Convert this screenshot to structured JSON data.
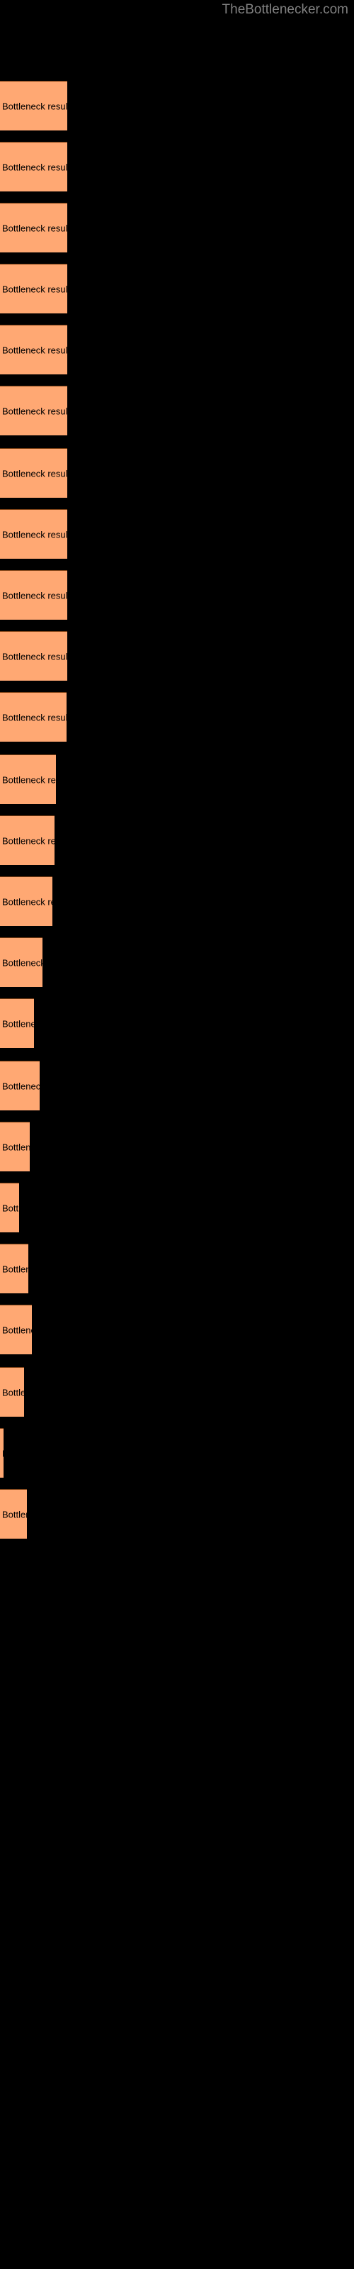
{
  "site": {
    "title": "TheBottlenecker.com",
    "title_color": "#808080"
  },
  "background_color": "#000000",
  "chart_data": {
    "type": "bar",
    "orientation": "horizontal",
    "title": "",
    "xlabel": "",
    "ylabel": "",
    "bar_color": "#FFA873",
    "bar_border_color": "#7a3f14",
    "label_color": "#000000",
    "grid": false,
    "legend": null,
    "bar_label": "Bottleneck result",
    "categories": [
      "Bottleneck result",
      "Bottleneck result",
      "Bottleneck result",
      "Bottleneck result",
      "Bottleneck result",
      "Bottleneck result",
      "Bottleneck result",
      "Bottleneck result",
      "Bottleneck result",
      "Bottleneck result",
      "Bottleneck result",
      "Bottleneck result",
      "Bottleneck result",
      "Bottleneck result",
      "Bottleneck result",
      "Bottleneck result",
      "Bottleneck result",
      "Bottleneck result",
      "Bottleneck result",
      "Bottleneck result",
      "Bottleneck result",
      "Bottleneck result",
      "Bottleneck result",
      "Bottleneck result"
    ],
    "values": [
      95,
      95,
      95,
      95,
      95,
      95,
      95,
      95,
      95,
      95,
      94,
      79,
      77,
      74,
      60,
      48,
      56,
      42,
      27,
      40,
      45,
      34,
      5,
      38
    ],
    "xlim": [
      0,
      500
    ],
    "bars": [
      {
        "index": 1,
        "label": "Bottleneck result",
        "top": 57,
        "height": 35,
        "width": 95
      },
      {
        "index": 2,
        "label": "Bottleneck result",
        "top": 100,
        "height": 35,
        "width": 95
      },
      {
        "index": 3,
        "label": "Bottleneck result",
        "top": 143,
        "height": 35,
        "width": 95
      },
      {
        "index": 4,
        "label": "Bottleneck result",
        "top": 186,
        "height": 35,
        "width": 95
      },
      {
        "index": 5,
        "label": "Bottleneck result",
        "top": 229,
        "height": 35,
        "width": 95
      },
      {
        "index": 6,
        "label": "Bottleneck result",
        "top": 272,
        "height": 35,
        "width": 95
      },
      {
        "index": 7,
        "label": "Bottleneck result",
        "top": 316,
        "height": 35,
        "width": 95
      },
      {
        "index": 8,
        "label": "Bottleneck result",
        "top": 359,
        "height": 35,
        "width": 95
      },
      {
        "index": 9,
        "label": "Bottleneck result",
        "top": 402,
        "height": 35,
        "width": 95
      },
      {
        "index": 10,
        "label": "Bottleneck result",
        "top": 445,
        "height": 35,
        "width": 95
      },
      {
        "index": 11,
        "label": "Bottleneck result",
        "top": 488,
        "height": 35,
        "width": 94
      },
      {
        "index": 12,
        "label": "Bottleneck result",
        "top": 532,
        "height": 35,
        "width": 79
      },
      {
        "index": 13,
        "label": "Bottleneck result",
        "top": 575,
        "height": 35,
        "width": 77
      },
      {
        "index": 14,
        "label": "Bottleneck result",
        "top": 618,
        "height": 35,
        "width": 74
      },
      {
        "index": 15,
        "label": "Bottleneck result",
        "top": 661,
        "height": 35,
        "width": 60
      },
      {
        "index": 16,
        "label": "Bottleneck result",
        "top": 704,
        "height": 35,
        "width": 48
      },
      {
        "index": 17,
        "label": "Bottleneck result",
        "top": 748,
        "height": 35,
        "width": 56
      },
      {
        "index": 18,
        "label": "Bottleneck result",
        "top": 791,
        "height": 35,
        "width": 42
      },
      {
        "index": 19,
        "label": "Bottleneck result",
        "top": 834,
        "height": 35,
        "width": 27
      },
      {
        "index": 20,
        "label": "Bottleneck result",
        "top": 877,
        "height": 35,
        "width": 40
      },
      {
        "index": 21,
        "label": "Bottleneck result",
        "top": 920,
        "height": 35,
        "width": 45
      },
      {
        "index": 22,
        "label": "Bottleneck result",
        "top": 964,
        "height": 35,
        "width": 34
      },
      {
        "index": 23,
        "label": "Bottleneck result",
        "top": 1007,
        "height": 35,
        "width": 5
      },
      {
        "index": 24,
        "label": "Bottleneck result",
        "top": 1050,
        "height": 35,
        "width": 38
      }
    ]
  }
}
